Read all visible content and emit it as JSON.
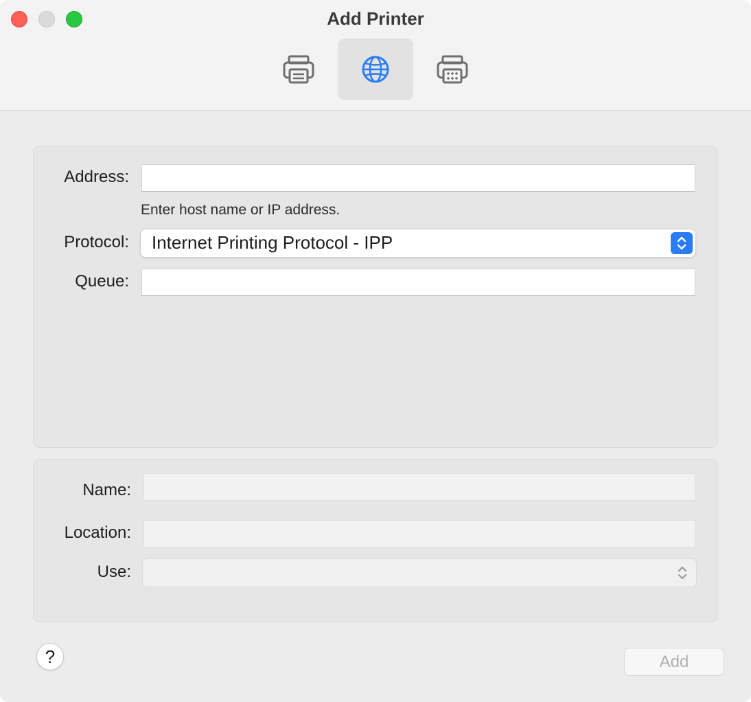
{
  "window": {
    "title": "Add Printer"
  },
  "toolbar": {
    "items": [
      {
        "name": "default",
        "icon": "printer-icon",
        "selected": false
      },
      {
        "name": "ip",
        "icon": "globe-icon",
        "selected": true
      },
      {
        "name": "windows",
        "icon": "fax-printer-icon",
        "selected": false
      }
    ]
  },
  "connection": {
    "address_label": "Address:",
    "address_value": "",
    "address_hint": "Enter host name or IP address.",
    "protocol_label": "Protocol:",
    "protocol_value": "Internet Printing Protocol - IPP",
    "queue_label": "Queue:",
    "queue_value": ""
  },
  "details": {
    "name_label": "Name:",
    "name_value": "",
    "location_label": "Location:",
    "location_value": "",
    "use_label": "Use:",
    "use_value": ""
  },
  "footer": {
    "help_label": "?",
    "add_label": "Add"
  },
  "colors": {
    "accent": "#2a7cf5",
    "close": "#fe5f57",
    "zoom": "#28c840"
  }
}
